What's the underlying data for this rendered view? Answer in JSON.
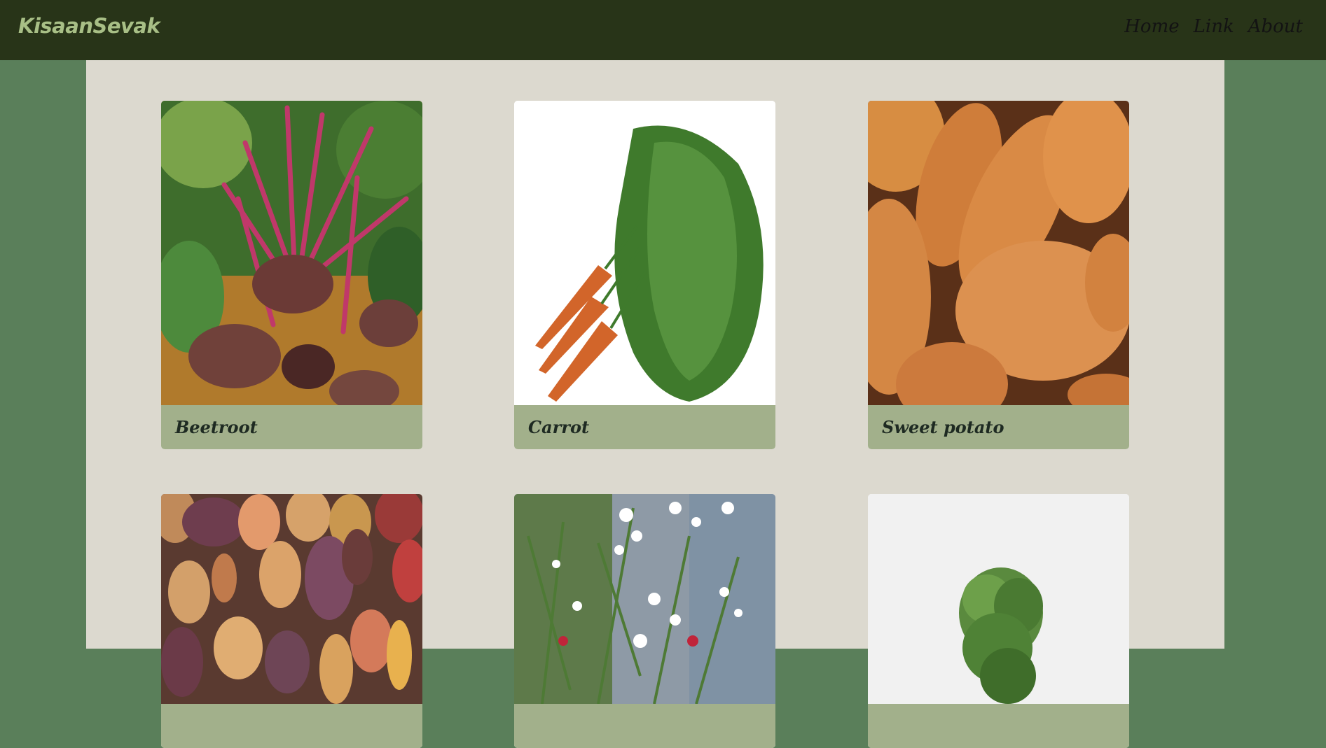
{
  "navbar": {
    "brand": "KisaanSevak",
    "links": [
      "Home",
      "Link",
      "About"
    ]
  },
  "cards": [
    {
      "label": "Beetroot",
      "image": "beetroot-photo"
    },
    {
      "label": "Carrot",
      "image": "carrot-photo"
    },
    {
      "label": "Sweet potato",
      "image": "sweet-potato-photo"
    },
    {
      "label": "",
      "image": "potatoes-photo"
    },
    {
      "label": "",
      "image": "flowering-plant-photo"
    },
    {
      "label": "",
      "image": "leafy-greens-photo"
    }
  ]
}
